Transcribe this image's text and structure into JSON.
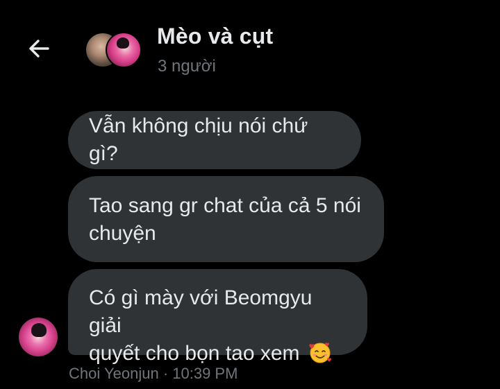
{
  "header": {
    "back_icon": "arrow-left-icon",
    "title": "Mèo và cụt",
    "subtitle": "3 người"
  },
  "messages": [
    {
      "text": "Vẫn không chịu nói chứ gì?"
    },
    {
      "line1": "Tao sang gr chat của cả 5 nói",
      "line2": "chuyện"
    },
    {
      "line1": "Có gì mày với Beomgyu giải",
      "line2": "quyết cho bọn tao xem",
      "emoji": "smiling-face-with-hearts-icon"
    }
  ],
  "meta": {
    "sender": "Choi Yeonjun",
    "separator": "·",
    "time": "10:39 PM"
  },
  "colors": {
    "background": "#000000",
    "bubble": "#2f3336",
    "text": "#e7e9ea",
    "muted": "#71767b"
  }
}
